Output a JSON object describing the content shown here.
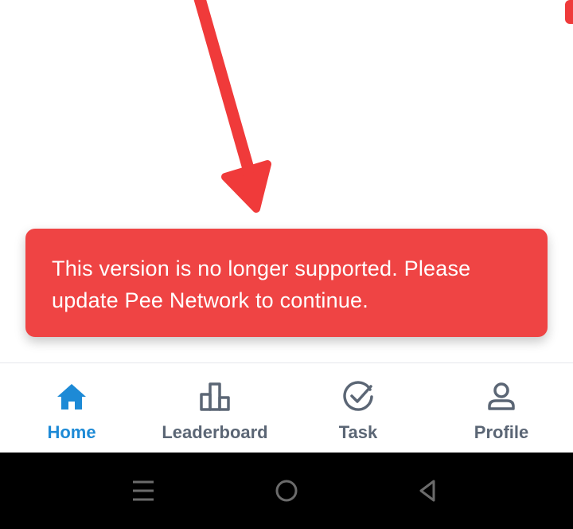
{
  "toast": {
    "message": "This version is no longer supported. Please update Pee Network to continue."
  },
  "nav": {
    "items": [
      {
        "label": "Home",
        "icon": "home-icon",
        "active": true
      },
      {
        "label": "Leaderboard",
        "icon": "leaderboard-icon",
        "active": false
      },
      {
        "label": "Task",
        "icon": "check-circle-icon",
        "active": false
      },
      {
        "label": "Profile",
        "icon": "person-icon",
        "active": false
      }
    ]
  },
  "system_nav": {
    "buttons": [
      "recent-apps-icon",
      "home-circle-icon",
      "back-triangle-icon"
    ]
  },
  "colors": {
    "toast_background": "#ef4444",
    "annotation_arrow": "#f03a3a",
    "nav_active": "#1d8ad6",
    "nav_inactive": "#5b6675",
    "system_bar": "#000000"
  }
}
